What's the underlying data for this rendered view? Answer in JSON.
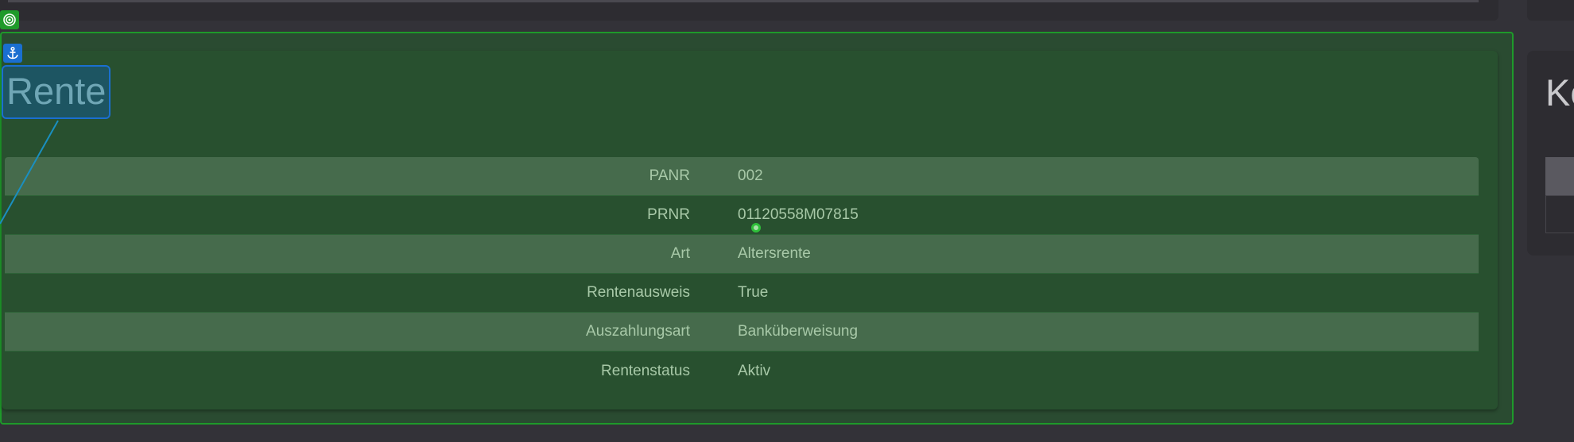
{
  "card": {
    "title": "Rente"
  },
  "details": [
    {
      "label": "PANR",
      "value": "002"
    },
    {
      "label": "PRNR",
      "value": "01120558M07815"
    },
    {
      "label": "Art",
      "value": "Altersrente"
    },
    {
      "label": "Rentenausweis",
      "value": "True"
    },
    {
      "label": "Auszahlungsart",
      "value": "Banküberweisung"
    },
    {
      "label": "Rentenstatus",
      "value": "Aktiv"
    }
  ],
  "side_card": {
    "title": "Ko"
  },
  "icons": {
    "target": "target-icon",
    "anchor": "anchor-icon"
  },
  "colors": {
    "selection_green": "#1e9a2a",
    "selection_blue": "#1a6fd0",
    "card_bg": "#28502f",
    "row_alt": "#466b4c",
    "page_bg": "#333238"
  }
}
